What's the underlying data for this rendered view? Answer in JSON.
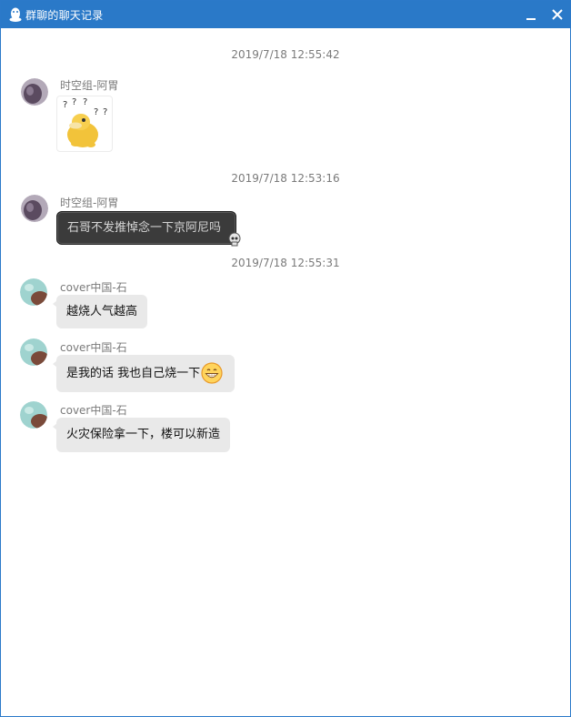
{
  "window": {
    "title": "群聊的聊天记录"
  },
  "icons": {
    "app": "qq-penguin-icon",
    "minimize": "minimize-icon",
    "close": "close-icon",
    "skull": "skull-icon",
    "grin": "grin-emoji-icon",
    "sticker": "confused-duck-sticker"
  },
  "messages": [
    {
      "timestamp": "2019/7/18 12:55:42",
      "sender": "时空组-阿胃",
      "text": ""
    },
    {
      "timestamp": "2019/7/18 12:53:16",
      "sender": "时空组-阿胃",
      "text": "石哥不发推悼念一下京阿尼吗"
    },
    {
      "timestamp": "2019/7/18 12:55:31",
      "sender": "cover中国-石",
      "text": "越烧人气越高"
    },
    {
      "timestamp": "",
      "sender": "cover中国-石",
      "text": "是我的话 我也自己烧一下"
    },
    {
      "timestamp": "",
      "sender": "cover中国-石",
      "text": "火灾保险拿一下，楼可以新造"
    }
  ],
  "colors": {
    "titlebar": "#2a79c8",
    "bubble": "#e9e9e9",
    "dark_bubble": "#3b3b3b",
    "timestamp": "#7a7a7a"
  }
}
